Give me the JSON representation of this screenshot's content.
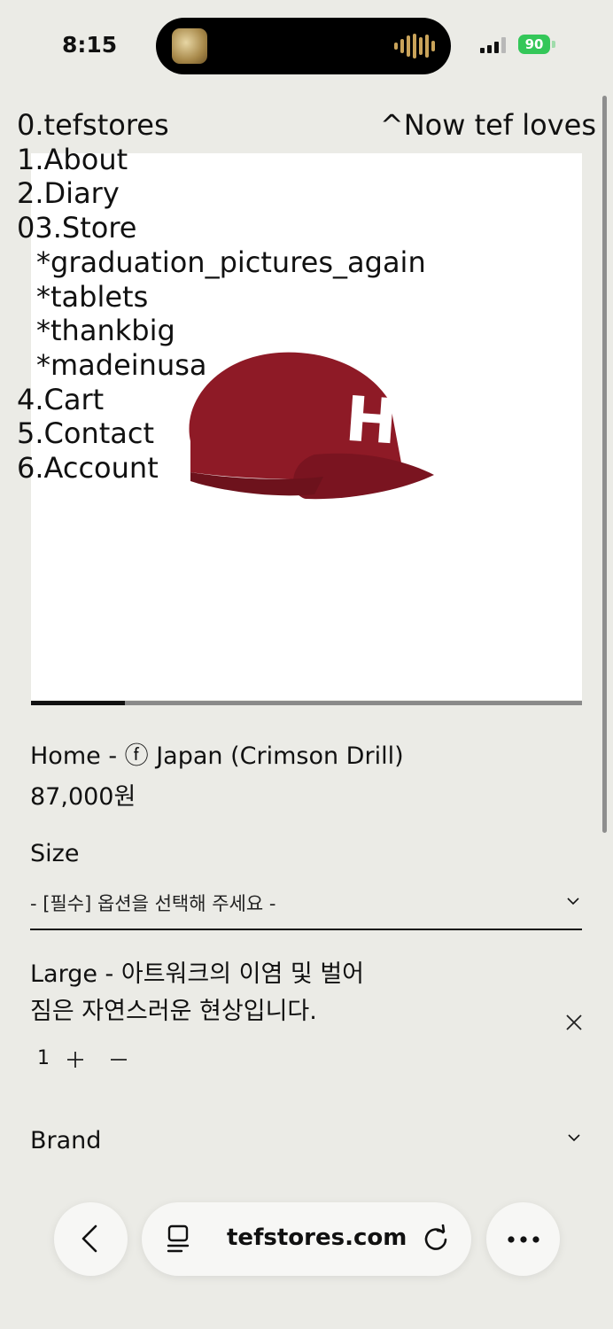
{
  "status": {
    "time": "8:15",
    "battery": "90"
  },
  "menu": {
    "items": [
      {
        "label": "0.tefstores"
      },
      {
        "label": "1.About"
      },
      {
        "label": "2.Diary"
      },
      {
        "label": "03.Store"
      },
      {
        "label": "*graduation_pictures_again"
      },
      {
        "label": "*tablets"
      },
      {
        "label": "*thankbig"
      },
      {
        "label": "*madeinusa"
      },
      {
        "label": "4.Cart"
      },
      {
        "label": "5.Contact"
      },
      {
        "label": "6.Account"
      }
    ],
    "tagline": "^Now tef loves"
  },
  "product": {
    "cap_letter": "H",
    "cap_color": "#8e1a26",
    "name": "Home - ⓕ Japan (Crimson Drill)",
    "price": "87,000원",
    "image_progress": 0.17,
    "size_label": "Size",
    "size_placeholder": "- [필수] 옵션을 선택해 주세요 -",
    "selected_option": {
      "line1": "Large - 아트워크의 이염 및 벌어",
      "line2": "짐은 자연스러운 현상입니다.",
      "quantity": "1"
    },
    "brand_label": "Brand"
  },
  "browser": {
    "url": "tefstores.com"
  }
}
